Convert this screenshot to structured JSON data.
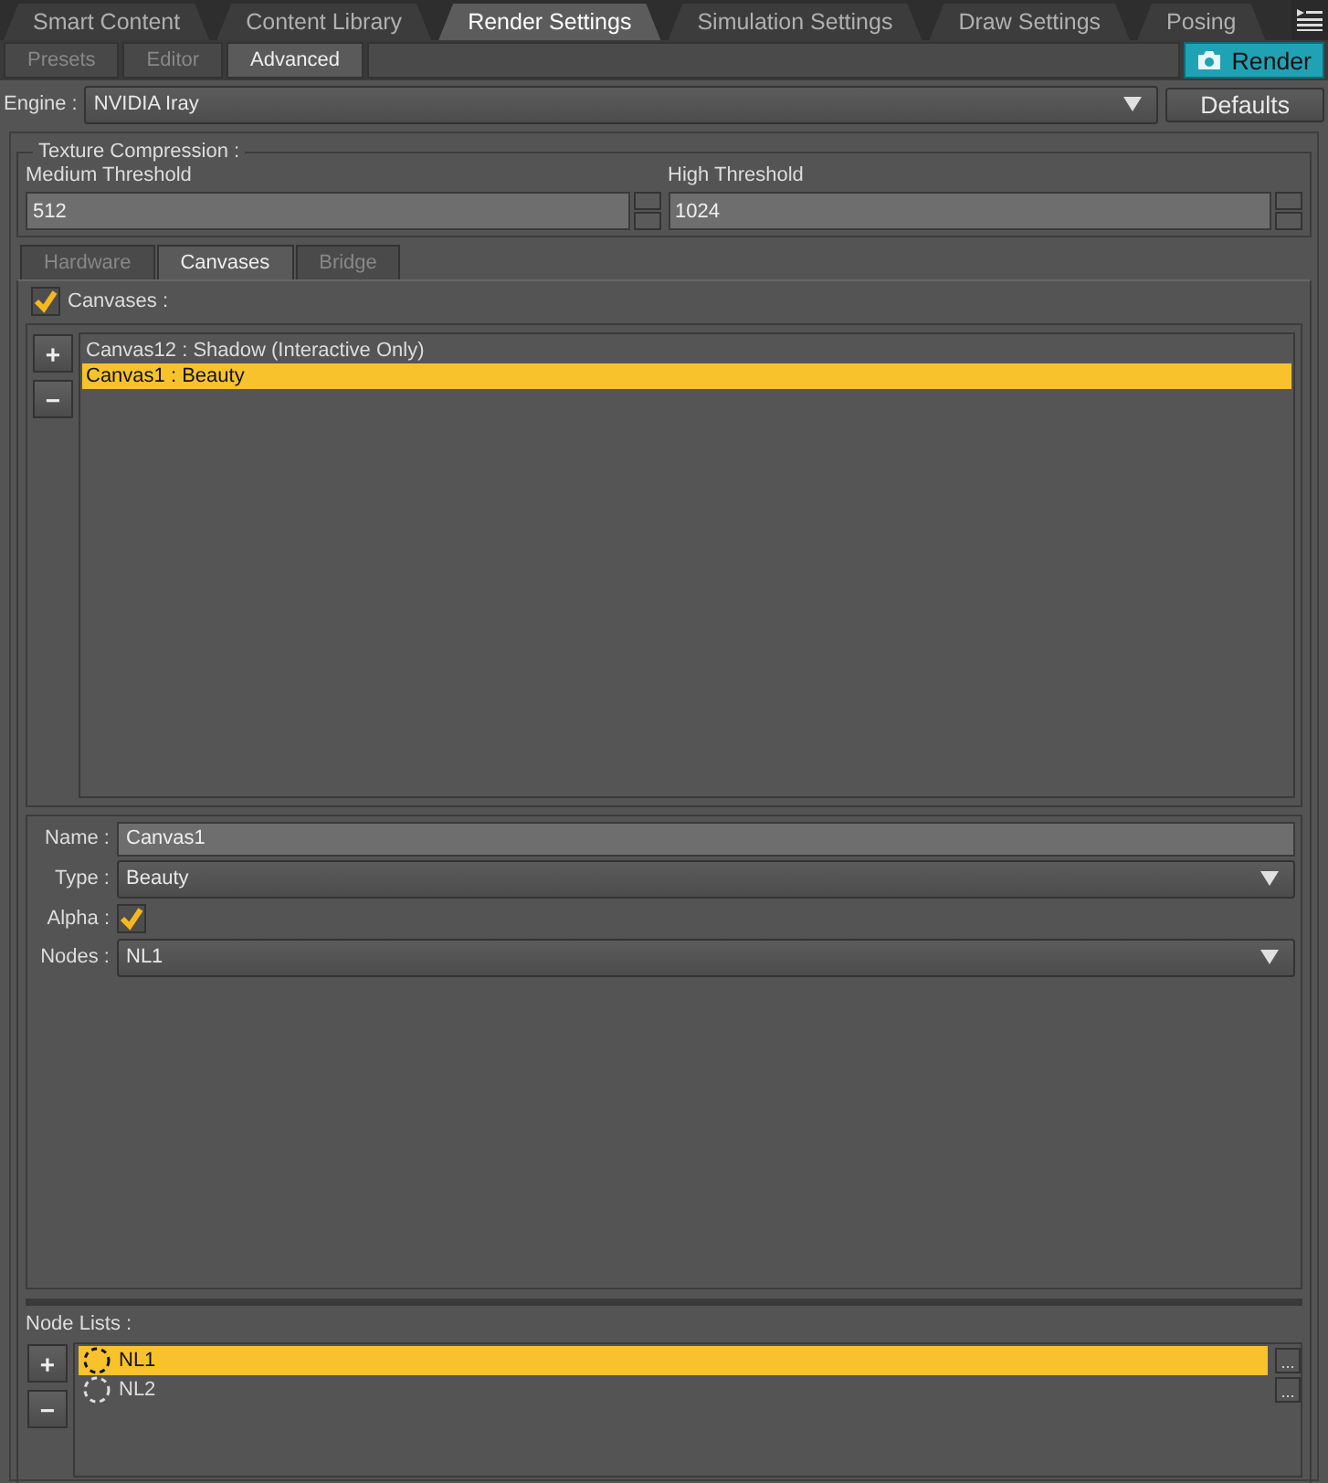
{
  "main_tabs": [
    {
      "label": "Smart Content",
      "selected": false
    },
    {
      "label": "Content Library",
      "selected": false
    },
    {
      "label": "Render Settings",
      "selected": true
    },
    {
      "label": "Simulation Settings",
      "selected": false
    },
    {
      "label": "Draw Settings",
      "selected": false
    },
    {
      "label": "Posing",
      "selected": false
    }
  ],
  "sub_tabs": [
    {
      "label": "Presets",
      "selected": false
    },
    {
      "label": "Editor",
      "selected": false
    },
    {
      "label": "Advanced",
      "selected": true
    }
  ],
  "render_button": {
    "label": "Render"
  },
  "engine": {
    "label": "Engine :",
    "value": "NVIDIA Iray"
  },
  "defaults_button": {
    "label": "Defaults"
  },
  "texture_compression": {
    "title": "Texture Compression :",
    "fields": [
      {
        "label": "Medium Threshold",
        "value": "512"
      },
      {
        "label": "High Threshold",
        "value": "1024"
      }
    ]
  },
  "section_tabs": [
    {
      "label": "Hardware",
      "selected": false
    },
    {
      "label": "Canvases",
      "selected": true
    },
    {
      "label": "Bridge",
      "selected": false
    }
  ],
  "canvases": {
    "label": "Canvases :",
    "checked": true,
    "add_button": "+",
    "remove_button": "−",
    "items": [
      {
        "label": "Canvas12 : Shadow (Interactive Only)",
        "selected": false
      },
      {
        "label": "Canvas1 : Beauty",
        "selected": true
      }
    ]
  },
  "canvas_properties": [
    {
      "kind": "text",
      "label": "Name :",
      "value": "Canvas1"
    },
    {
      "kind": "dropdown",
      "label": "Type :",
      "value": "Beauty"
    },
    {
      "kind": "checkbox",
      "label": "Alpha :",
      "checked": true
    },
    {
      "kind": "dropdown",
      "label": "Nodes :",
      "value": "NL1"
    }
  ],
  "node_lists": {
    "label": "Node Lists :",
    "add_button": "+",
    "remove_button": "−",
    "items": [
      {
        "label": "NL1",
        "selected": true,
        "more_button": "..."
      },
      {
        "label": "NL2",
        "selected": false,
        "more_button": "..."
      }
    ]
  }
}
